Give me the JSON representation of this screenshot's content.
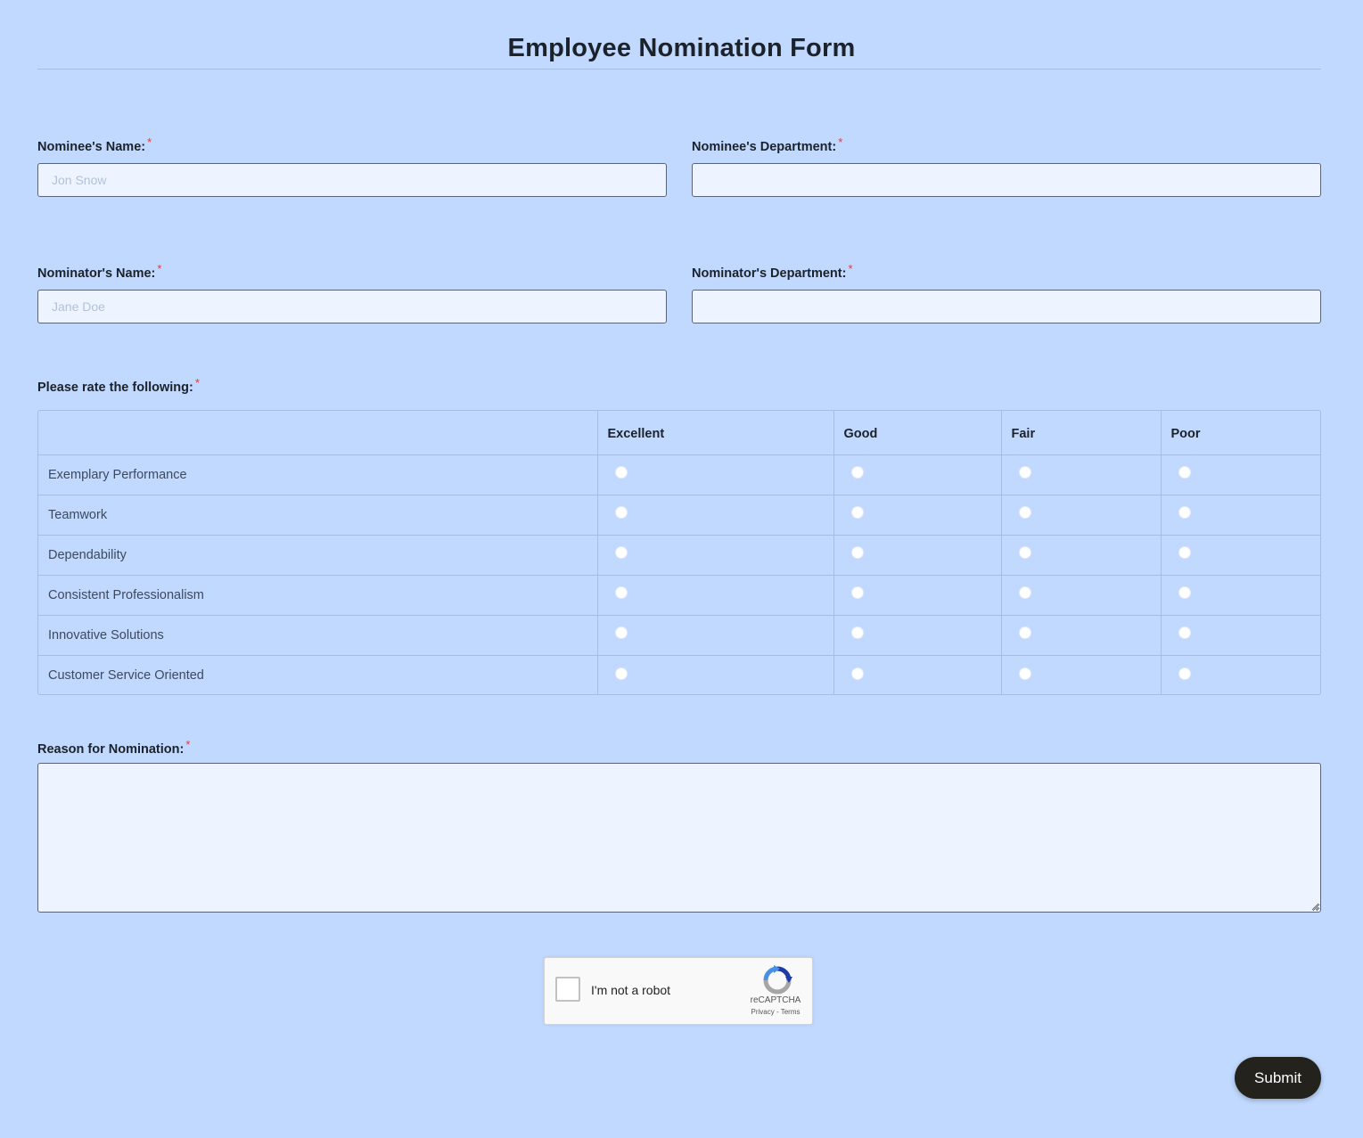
{
  "form": {
    "title": "Employee Nomination Form",
    "required_mark": "*",
    "nominee_name": {
      "label": "Nominee's Name:",
      "placeholder": "Jon Snow",
      "value": ""
    },
    "nominee_department": {
      "label": "Nominee's Department:",
      "placeholder": "",
      "value": ""
    },
    "nominator_name": {
      "label": "Nominator's Name:",
      "placeholder": "Jane Doe",
      "value": ""
    },
    "nominator_department": {
      "label": "Nominator's Department:",
      "placeholder": "",
      "value": ""
    },
    "rating": {
      "label": "Please rate the following:",
      "columns": [
        "Excellent",
        "Good",
        "Fair",
        "Poor"
      ],
      "rows": [
        "Exemplary Performance",
        "Teamwork",
        "Dependability",
        "Consistent Professionalism",
        "Innovative Solutions",
        "Customer Service Oriented"
      ]
    },
    "reason": {
      "label": "Reason for Nomination:",
      "value": ""
    },
    "captcha": {
      "text": "I'm not a robot",
      "brand": "reCAPTCHA",
      "privacy": "Privacy",
      "separator": " - ",
      "terms": "Terms"
    },
    "submit_label": "Submit"
  },
  "colors": {
    "background": "#c1d9fe",
    "input_background": "#edf4ff",
    "required": "#e23b3b",
    "submit_background": "#24221d"
  }
}
